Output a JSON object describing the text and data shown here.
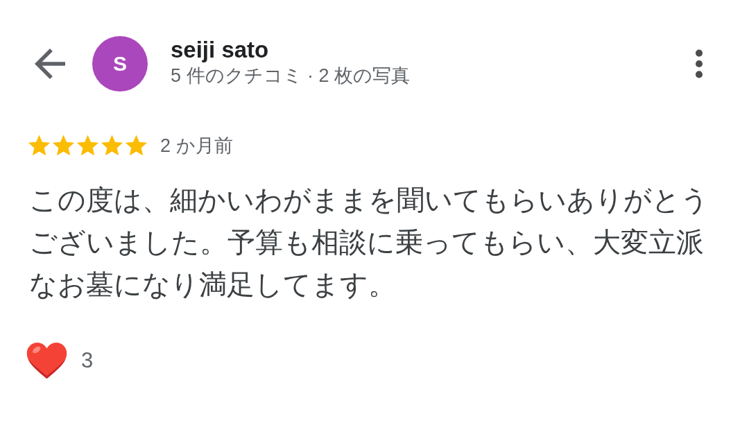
{
  "header": {
    "author": {
      "initial": "S",
      "name": "seiji sato",
      "stats": "5 件のクチコミ · 2 枚の写真"
    }
  },
  "review": {
    "stars": 5,
    "time": "2 か月前",
    "text": "この度は、細かいわがままを聞いてもらいありがとうございました。予算も相談に乗ってもらい、大変立派なお墓になり満足してます。",
    "reactions": {
      "count": "3"
    }
  }
}
